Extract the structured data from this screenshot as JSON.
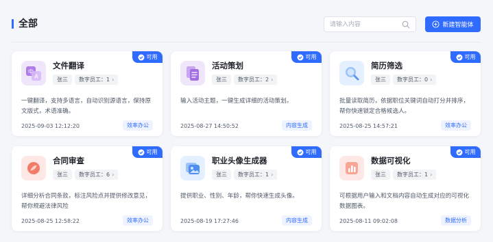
{
  "header": {
    "title": "全部",
    "search_placeholder": "请输入内容",
    "new_button_label": "新建智能体"
  },
  "colors": {
    "accent": "#2f6bff"
  },
  "cards": [
    {
      "name": "文件翻译",
      "status": "可用",
      "owner": "张三",
      "employees": "数字员工：1",
      "description": "一键翻译，支持多语言，自动识别源语言，保持原文版式，术语准确。",
      "date": "2025-09-03 12:12:20",
      "category": "效率办公",
      "icon": "translate-icon"
    },
    {
      "name": "活动策划",
      "status": "可用",
      "owner": "张三",
      "employees": "数字员工：2",
      "description": "输入活动主题，一键生成详细的活动策划。",
      "date": "2025-08-27 14:50:52",
      "category": "内容生成",
      "icon": "document-icon"
    },
    {
      "name": "简历筛选",
      "status": "可用",
      "owner": "张三",
      "employees": "数字员工：0",
      "description": "批量读取简历，依据职位关键词自动打分并排序，帮你快速锁定合格候选人。",
      "date": "2025-08-25 14:57:21",
      "category": "效率办公",
      "icon": "magnifier-icon"
    },
    {
      "name": "合同审查",
      "status": "可用",
      "owner": "张三",
      "employees": "数字员工：6",
      "description": "详细分析合同条款，标注风险点并提供修改意见，帮你规避法律风险",
      "date": "2025-08-25 12:58:22",
      "category": "效率办公",
      "icon": "contract-icon"
    },
    {
      "name": "职业头像生成器",
      "status": "可用",
      "owner": "张三",
      "employees": "数字员工：1",
      "description": "提供职业、性别、年龄，帮你快速生成头像。",
      "date": "2025-08-19 17:27:46",
      "category": "内容生成",
      "icon": "image-icon"
    },
    {
      "name": "数据可视化",
      "status": "可用",
      "owner": "张三",
      "employees": "数字员工：1",
      "description": "可根据用户输入和文档内容自动生成对应的可视化数据图表。",
      "date": "2025-08-11 09:02:08",
      "category": "数据分析",
      "icon": "chart-icon"
    }
  ]
}
